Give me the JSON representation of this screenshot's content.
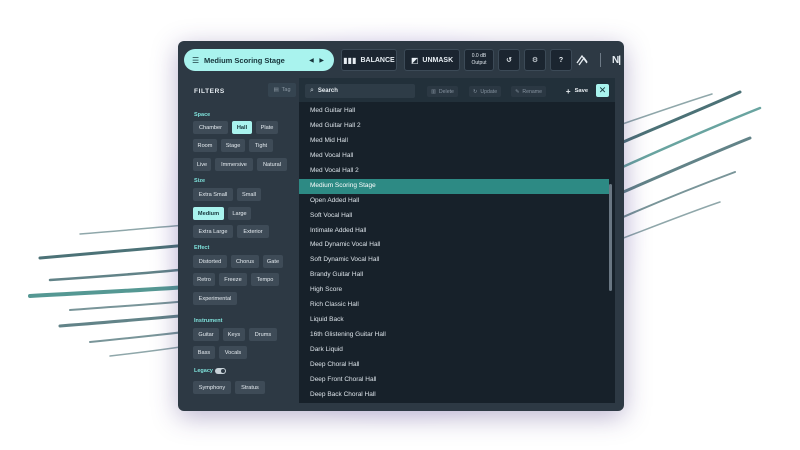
{
  "preset_selector": {
    "name": "Medium Scoring Stage",
    "arrows": "◀ ▶"
  },
  "toolbar": {
    "balance_label": "BALANCE",
    "unmask_label": "UNMASK",
    "output_value": "0.0 dB",
    "output_label": "Output"
  },
  "filters": {
    "title": "FILTERS",
    "tag_label": "Tag",
    "sections": {
      "space": "Space",
      "size": "Size",
      "effect": "Effect",
      "instrument": "Instrument",
      "legacy": "Legacy"
    },
    "chips": {
      "chamber": "Chamber",
      "hall": "Hall",
      "plate": "Plate",
      "room": "Room",
      "stage": "Stage",
      "tight": "Tight",
      "live": "Live",
      "immersive": "Immersive",
      "natural": "Natural",
      "extra_small": "Extra Small",
      "small": "Small",
      "medium": "Medium",
      "large": "Large",
      "extra_large": "Extra Large",
      "exterior": "Exterior",
      "distorted": "Distorted",
      "chorus": "Chorus",
      "gate": "Gate",
      "retro": "Retro",
      "freeze": "Freeze",
      "tempo": "Tempo",
      "experimental": "Experimental",
      "guitar": "Guitar",
      "keys": "Keys",
      "drums": "Drums",
      "bass": "Bass",
      "vocals": "Vocals",
      "symphony": "Symphony",
      "stratus": "Stratus"
    }
  },
  "list_toolbar": {
    "search_placeholder": "Search",
    "delete_label": "Delete",
    "update_label": "Update",
    "rename_label": "Rename",
    "save_label": "Save"
  },
  "presets": [
    "Med Guitar Hall",
    "Med Guitar Hall 2",
    "Med Mid Hall",
    "Med Vocal Hall",
    "Med Vocal Hall 2",
    "Medium Scoring Stage",
    "Open Added Hall",
    "Soft Vocal Hall",
    "Intimate Added Hall",
    "Med Dynamic Vocal Hall",
    "Soft Dynamic Vocal Hall",
    "Brandy Guitar Hall",
    "High Score",
    "Rich Classic Hall",
    "Liquid Back",
    "16th Glistening Guitar Hall",
    "Dark Liquid",
    "Deep Choral Hall",
    "Deep Front Choral Hall",
    "Deep Back Choral Hall"
  ],
  "selected_preset_index": 5,
  "colors": {
    "accent": "#a9f3ee",
    "selected_row": "#2d8a84",
    "section_label": "#7fe3dc",
    "panel": "#2d3944",
    "list_bg": "#17212a"
  }
}
